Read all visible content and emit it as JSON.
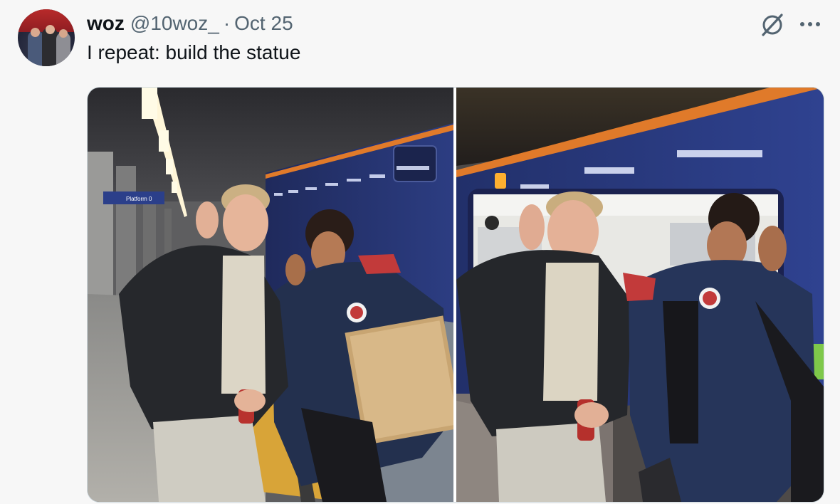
{
  "tweet": {
    "author_name": "woz",
    "handle": "@10woz_",
    "separator": "·",
    "date": "Oct 25",
    "text": "I repeat: build the statue"
  },
  "photos": [
    {
      "sign_text": "Platform 0"
    },
    {}
  ],
  "icons": {
    "grok": "grok-icon",
    "more": "more-options-icon"
  },
  "colors": {
    "name": "#0f1419",
    "secondary": "#536471",
    "train_blue": "#2b3a78",
    "train_stripe": "#e07a2a",
    "tactile_yellow": "#e2b23a"
  }
}
